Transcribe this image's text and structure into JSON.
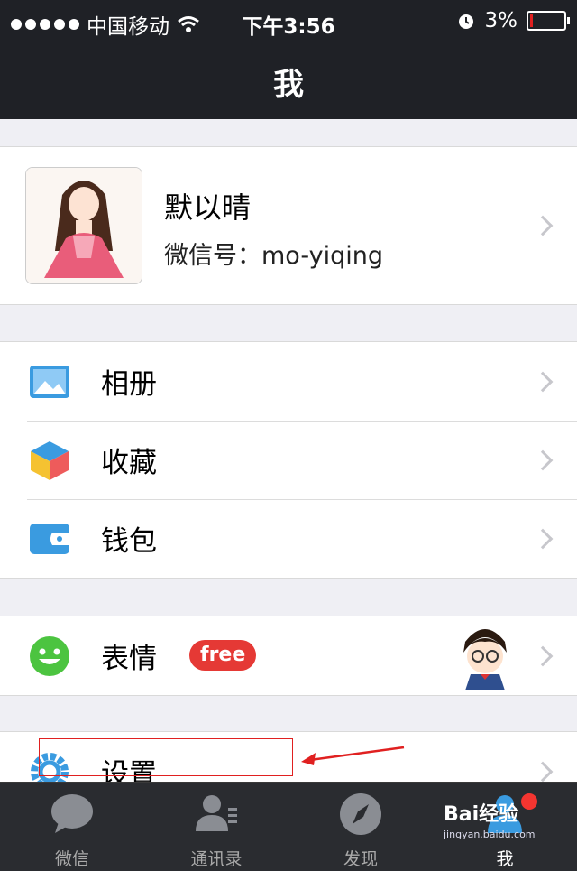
{
  "status_bar": {
    "carrier": "中国移动",
    "time": "下午3:56",
    "battery": "3%"
  },
  "nav": {
    "title": "我"
  },
  "profile": {
    "name": "默以晴",
    "wechat_id": "微信号：mo-yiqing"
  },
  "menu": {
    "album": "相册",
    "favorites": "收藏",
    "wallet": "钱包",
    "stickers": "表情",
    "stickers_badge": "free",
    "settings": "设置"
  },
  "tabs": [
    {
      "label": "微信",
      "icon": "chat-bubble-icon"
    },
    {
      "label": "通讯录",
      "icon": "contacts-icon"
    },
    {
      "label": "发现",
      "icon": "compass-icon"
    },
    {
      "label": "我",
      "icon": "person-icon"
    }
  ],
  "watermark": {
    "brand": "Bai经验",
    "url": "jingyan.baidu.com"
  },
  "colors": {
    "bar_bg": "#1f2126",
    "accent_blue": "#3a9be0",
    "badge_red": "#e53935",
    "green": "#4cc440"
  }
}
